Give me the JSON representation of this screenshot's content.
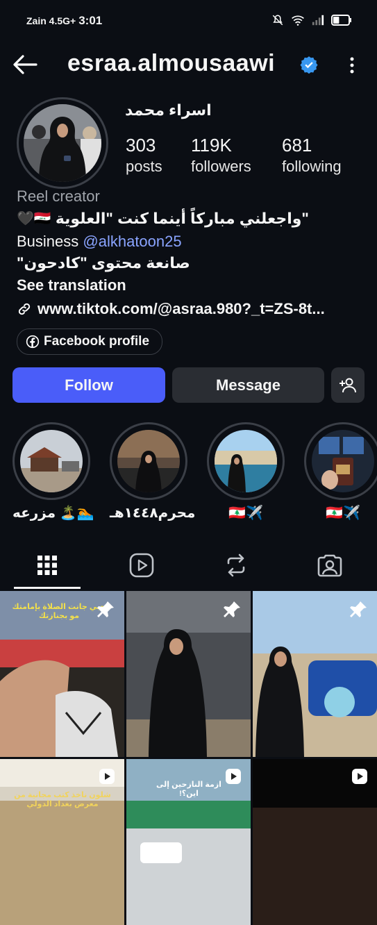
{
  "status": {
    "carrier": "Zain 4.5G+",
    "time": "3:01",
    "battery_percent": 40
  },
  "header": {
    "username": "esraa.almousaawi",
    "verified": true,
    "back_icon": "arrow-left-icon",
    "more_icon": "more-vertical-icon"
  },
  "profile": {
    "full_name": "اسراء محمد",
    "stats": [
      {
        "value": "303",
        "label": "posts"
      },
      {
        "value": "119K",
        "label": "followers"
      },
      {
        "value": "681",
        "label": "following"
      }
    ],
    "category": "Reel creator",
    "bio_line1": "\"واجعلني مباركاً أينما كنت \"العلوية",
    "bio_line1_emoji": "🇮🇶🖤",
    "bio_business": "Business ",
    "bio_mention": "@alkhatoon25",
    "bio_line3": "\"صانعة محتوى \"كادحون",
    "see_translation": "See translation",
    "link": "www.tiktok.com/@asraa.980?_t=ZS-8t...",
    "facebook_label": "Facebook profile"
  },
  "actions": {
    "follow": "Follow",
    "message": "Message"
  },
  "highlights": [
    {
      "label": "مزرعه 🏝️🏊",
      "colors": [
        "#c7ccd3",
        "#6b4b3a"
      ]
    },
    {
      "label": "محرم١٤٤٨هـ",
      "colors": [
        "#7a6a5a",
        "#1a1a1a"
      ]
    },
    {
      "label": "🇱🇧✈️",
      "colors": [
        "#9cc6e6",
        "#2f6e8c"
      ]
    },
    {
      "label": "🇱🇧✈️",
      "colors": [
        "#1f2a3a",
        "#5b3a2a"
      ]
    }
  ],
  "tabs": [
    "grid-icon",
    "reels-icon",
    "reposts-icon",
    "tagged-icon"
  ],
  "grid": {
    "cell_overlays": [
      "حبي جانت الصلاة بإمامتك مو بجنازتك",
      "شلون ناخذ كتب مجانية من معرض بغداد الدولي",
      "ازمة النازحين إلى اين؟!"
    ]
  },
  "colors": {
    "accent": "#4a5df9",
    "background": "#0b0e14",
    "button_gray": "#2a2d33",
    "mention": "#8aa4ff",
    "verified": "#3897f0"
  }
}
